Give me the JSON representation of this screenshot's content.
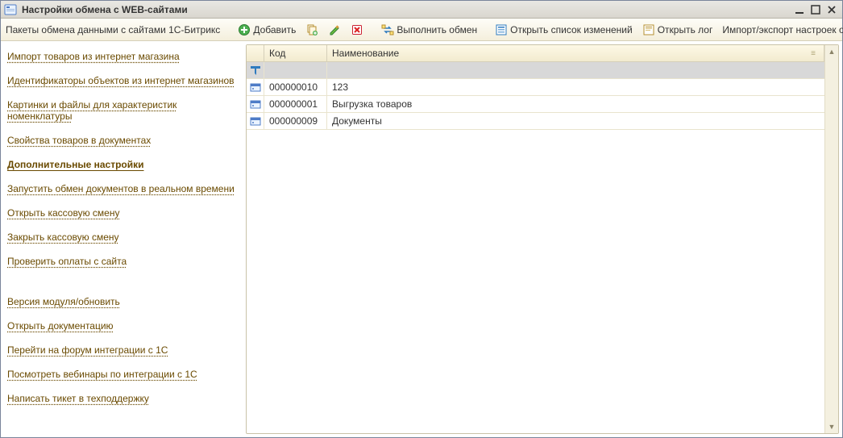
{
  "window": {
    "title": "Настройки обмена с WEB-сайтами"
  },
  "toolbar": {
    "packages_label": "Пакеты обмена данными с сайтами 1С-Битрикс",
    "add_label": "Добавить",
    "run_exchange_label": "Выполнить обмен",
    "open_changes_label": "Открыть список изменений",
    "open_log_label": "Открыть лог",
    "import_export_label": "Импорт/экспорт настроек обмена"
  },
  "sidebar": {
    "items": [
      {
        "label": "Импорт товаров из интернет магазина",
        "selected": "no"
      },
      {
        "label": "Идентификаторы объектов из интернет магазинов",
        "selected": "no"
      },
      {
        "label": "Картинки и файлы для характеристик номенклатуры",
        "selected": "no"
      },
      {
        "label": "Свойства товаров в документах",
        "selected": "no"
      },
      {
        "label": "Дополнительные настройки",
        "selected": "yes"
      },
      {
        "label": "Запустить обмен документов в реальном времени",
        "selected": "no"
      },
      {
        "label": "Открыть кассовую смену",
        "selected": "no"
      },
      {
        "label": "Закрыть кассовую смену",
        "selected": "no"
      },
      {
        "label": "Проверить оплаты с сайта",
        "selected": "no"
      }
    ],
    "items2": [
      {
        "label": "Версия модуля/обновить"
      },
      {
        "label": "Открыть документацию"
      },
      {
        "label": "Перейти на форум интеграции с 1С"
      },
      {
        "label": "Посмотреть вебинары по интеграции с 1С"
      },
      {
        "label": "Написать тикет в техподдержку"
      }
    ]
  },
  "grid": {
    "columns": {
      "code": "Код",
      "name": "Наименование"
    },
    "rows": [
      {
        "code": "000000010",
        "name": "123"
      },
      {
        "code": "000000001",
        "name": "Выгрузка товаров"
      },
      {
        "code": "000000009",
        "name": "Документы"
      }
    ]
  }
}
